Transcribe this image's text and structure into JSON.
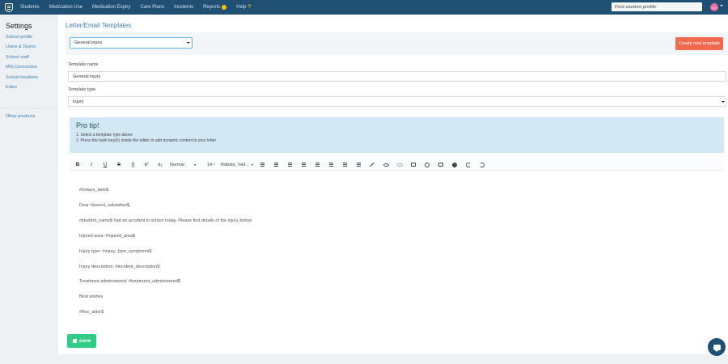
{
  "topnav": {
    "items": [
      "Students",
      "Medication Use",
      "Medication Expiry",
      "Care Plans",
      "Incidents",
      "Reports",
      "Help"
    ],
    "help_mark": "?",
    "find_placeholder": "Find student profile",
    "avatar_initials": "CH"
  },
  "sidebar": {
    "title": "Settings",
    "links": [
      "School profile",
      "Users & Teams",
      "School staff",
      "MIS Connection",
      "School locations",
      "Editor"
    ],
    "other": "Other products"
  },
  "page": {
    "title": "Letter/Email Templates",
    "selected_template": "General injury",
    "create_label": "Create new template"
  },
  "form": {
    "name_label": "Template name",
    "name_value": "General injury",
    "type_label": "Template type",
    "type_value": "Injury"
  },
  "protip": {
    "title": "Pro tip!",
    "lines": [
      "1. Select a template type above",
      "2. Press the hash key(#) inside the editor to add dynamic content to your letter"
    ]
  },
  "toolbar": {
    "bold": "B",
    "italic": "I",
    "underline": "U",
    "strike": "S",
    "code": "{}",
    "superscript": "x²",
    "subscript": "x₂",
    "style": "Normal",
    "size": "14 ᵖ",
    "font": "Roboto, 'Hel..."
  },
  "editor": {
    "lines": [
      "#todays_date$",
      "Dear #parent_salutation$,",
      "#student_name$ had an accident in school today. Please find details of the injury below:",
      "Injured area: #injured_area$",
      "Injury type: #injury_type_symptoms$",
      "Injury description: #incident_description$",
      "Treatment administered: #treatment_administered$",
      "Best wishes",
      " #first_aider$"
    ]
  },
  "save_label": "save",
  "colors": {
    "nav": "#1f4f72",
    "accent": "#3f7fb5",
    "create": "#f16a4f",
    "save": "#2fcc85",
    "protip": "#d2e8f5"
  }
}
